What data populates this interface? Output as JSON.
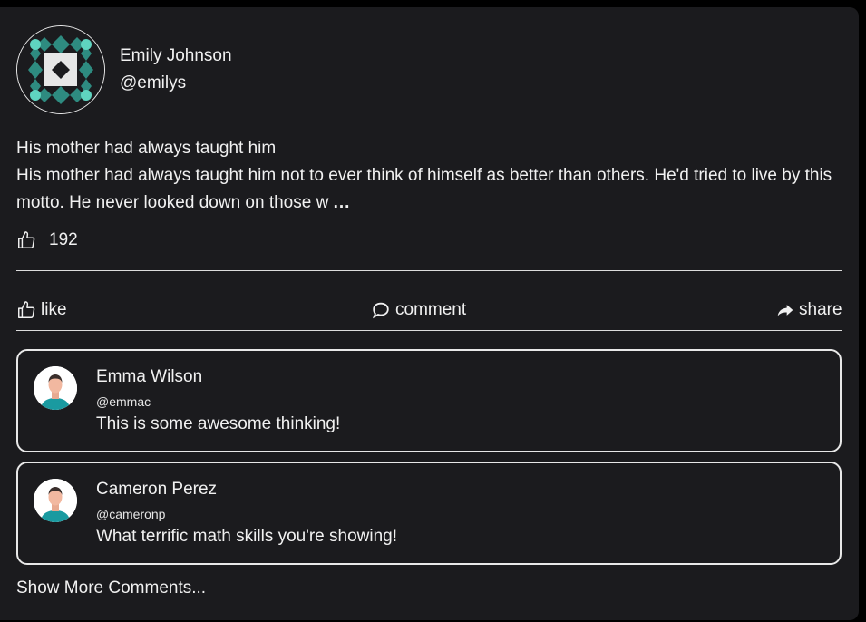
{
  "post": {
    "author_name": "Emily Johnson",
    "author_handle": "@emilys",
    "title": "His mother had always taught him",
    "body": "His mother had always taught him not to ever think of himself as better than others. He'd tried to live by this motto. He never looked down on those w",
    "more": "...",
    "likes": "192"
  },
  "actions": {
    "like": "like",
    "comment": "comment",
    "share": "share"
  },
  "comments": [
    {
      "name": "Emma Wilson",
      "handle": "@emmac",
      "text": "This is some awesome thinking!"
    },
    {
      "name": "Cameron Perez",
      "handle": "@cameronp",
      "text": "What terrific math skills you're showing!"
    }
  ],
  "show_more_label": "Show More Comments...",
  "colors": {
    "background": "#1b1b1e",
    "text": "#f1f1f1",
    "avatar_teal": "#2e8b80",
    "avatar_teal_light": "#5fd4c0",
    "comment_teal": "#1a9aa0"
  }
}
